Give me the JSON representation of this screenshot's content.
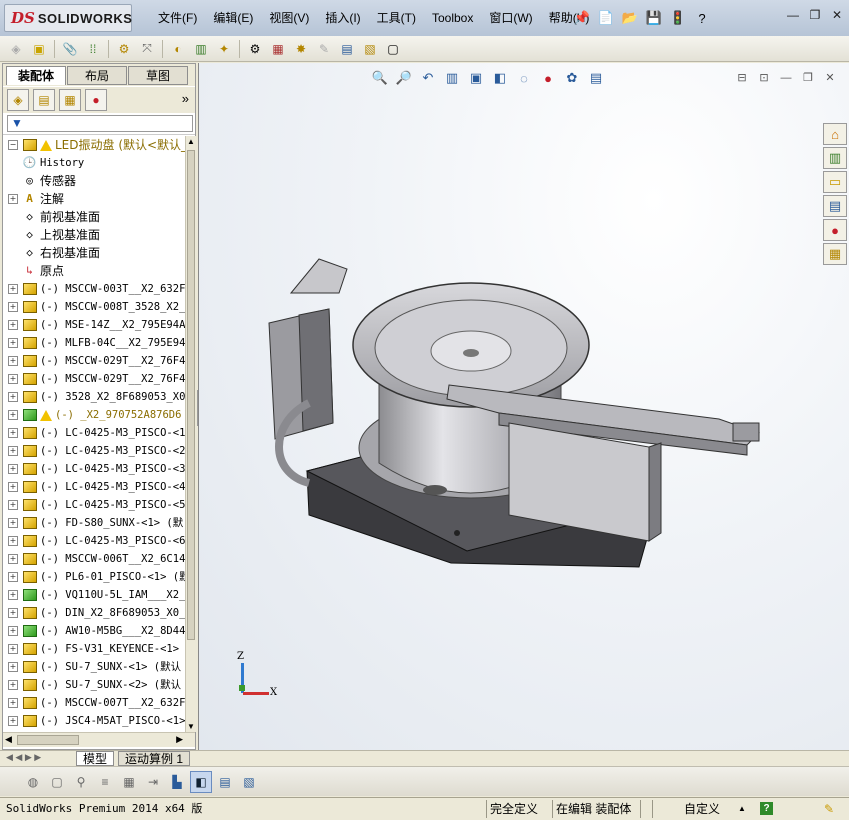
{
  "app": {
    "logo_ds": "DS",
    "logo_name": "SOLIDWORKS"
  },
  "menu": [
    "文件(F)",
    "编辑(E)",
    "视图(V)",
    "插入(I)",
    "工具(T)",
    "Toolbox",
    "窗口(W)",
    "帮助(H)"
  ],
  "panel": {
    "tabs": [
      "装配体",
      "布局",
      "草图"
    ],
    "active_tab": "装配体"
  },
  "tree": [
    {
      "text": "LED振动盘  (默认<默认_显",
      "icon": "assembly",
      "warn": true,
      "root": true,
      "expand": "minus"
    },
    {
      "text": "History",
      "icon": "history",
      "expand": "none"
    },
    {
      "text": "传感器",
      "icon": "sensor",
      "expand": "none"
    },
    {
      "text": "注解",
      "icon": "annotation",
      "expand": "plus"
    },
    {
      "text": "前视基准面",
      "icon": "plane",
      "expand": "none"
    },
    {
      "text": "上视基准面",
      "icon": "plane",
      "expand": "none"
    },
    {
      "text": "右视基准面",
      "icon": "plane",
      "expand": "none"
    },
    {
      "text": "原点",
      "icon": "origin",
      "expand": "none"
    },
    {
      "text": "(-) MSCCW-003T__X2_632F",
      "icon": "part",
      "expand": "plus"
    },
    {
      "text": "(-) MSCCW-008T_3528_X2_",
      "icon": "part",
      "expand": "plus"
    },
    {
      "text": "(-) MSE-14Z__X2_795E94A",
      "icon": "part",
      "expand": "plus"
    },
    {
      "text": "(-) MLFB-04C__X2_795E94",
      "icon": "part",
      "expand": "plus"
    },
    {
      "text": "(-) MSCCW-029T__X2_76F4",
      "icon": "part",
      "expand": "plus"
    },
    {
      "text": "(-) MSCCW-029T__X2_76F4",
      "icon": "part",
      "expand": "plus"
    },
    {
      "text": "(-) 3528_X2_8F689053_X0",
      "icon": "part",
      "expand": "plus"
    },
    {
      "text": "(-) _X2_970752A876D6",
      "icon": "part-green",
      "warn": true,
      "root": true,
      "expand": "plus"
    },
    {
      "text": "(-) LC-0425-M3_PISCO-<1",
      "icon": "part",
      "expand": "plus"
    },
    {
      "text": "(-) LC-0425-M3_PISCO-<2",
      "icon": "part",
      "expand": "plus"
    },
    {
      "text": "(-) LC-0425-M3_PISCO-<3",
      "icon": "part",
      "expand": "plus"
    },
    {
      "text": "(-) LC-0425-M3_PISCO-<4",
      "icon": "part",
      "expand": "plus"
    },
    {
      "text": "(-) LC-0425-M3_PISCO-<5",
      "icon": "part",
      "expand": "plus"
    },
    {
      "text": "(-) FD-S80_SUNX-<1> (默",
      "icon": "part",
      "expand": "plus"
    },
    {
      "text": "(-) LC-0425-M3_PISCO-<6",
      "icon": "part",
      "expand": "plus"
    },
    {
      "text": "(-) MSCCW-006T__X2_6C14",
      "icon": "part",
      "expand": "plus"
    },
    {
      "text": "(-) PL6-01_PISCO-<1> (默",
      "icon": "part",
      "expand": "plus"
    },
    {
      "text": "(-) VQ110U-5L_IAM___X2_",
      "icon": "part-green",
      "expand": "plus"
    },
    {
      "text": "(-) DIN_X2_8F689053_X0_",
      "icon": "part",
      "expand": "plus"
    },
    {
      "text": "(-) AW10-M5BG___X2_8D44",
      "icon": "part-green",
      "expand": "plus"
    },
    {
      "text": "(-) FS-V31_KEYENCE-<1>",
      "icon": "part",
      "expand": "plus"
    },
    {
      "text": "(-) SU-7_SUNX-<1> (默认",
      "icon": "part",
      "expand": "plus"
    },
    {
      "text": "(-) SU-7_SUNX-<2> (默认",
      "icon": "part",
      "expand": "plus"
    },
    {
      "text": "(-) MSCCW-007T__X2_632F",
      "icon": "part",
      "expand": "plus"
    },
    {
      "text": "(-) JSC4-M5AT_PISCO-<1>",
      "icon": "part",
      "expand": "plus"
    }
  ],
  "bottom_tabs": [
    "模型",
    "运动算例 1"
  ],
  "triad": {
    "x": "X",
    "z": "Z"
  },
  "status": {
    "product": "SolidWorks Premium 2014 x64 版",
    "defined": "完全定义",
    "mode": "在编辑 装配体",
    "units": "自定义",
    "caret": "▲",
    "help": "?"
  },
  "colors": {
    "accent": "#c41e2a",
    "warning": "#f2c200",
    "tree_root": "#8a6d00"
  }
}
